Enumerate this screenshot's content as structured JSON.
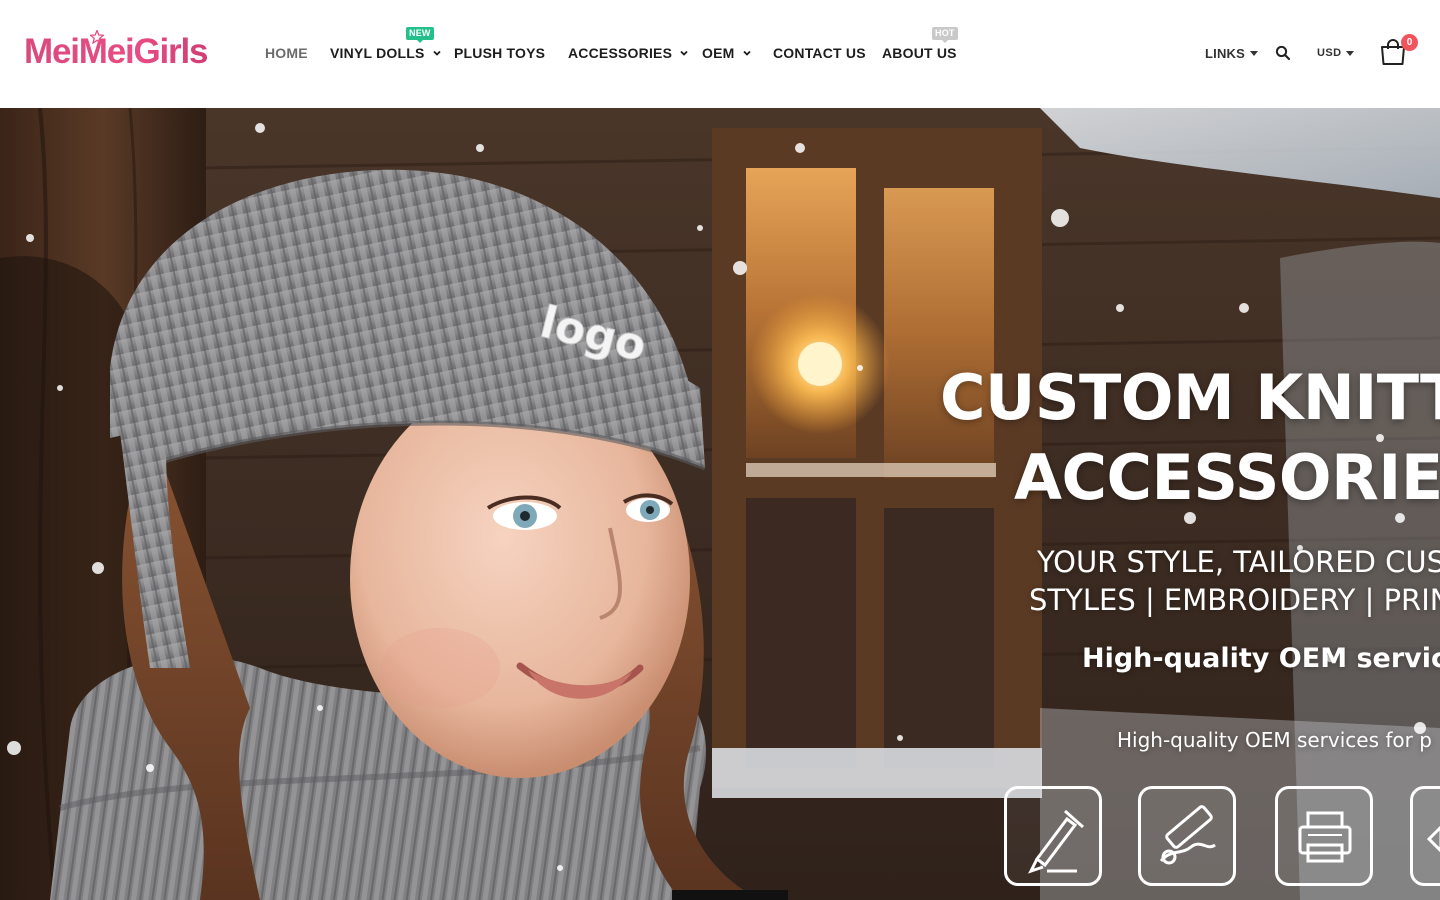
{
  "header": {
    "logo_text": "MeiMeiGirls",
    "nav": [
      {
        "label": "HOME",
        "active": true,
        "dropdown": false,
        "badge": null
      },
      {
        "label": "VINYL DOLLS",
        "active": false,
        "dropdown": true,
        "badge": "NEW"
      },
      {
        "label": "PLUSH TOYS",
        "active": false,
        "dropdown": false,
        "badge": null
      },
      {
        "label": "ACCESSORIES",
        "active": false,
        "dropdown": true,
        "badge": null
      },
      {
        "label": "OEM",
        "active": false,
        "dropdown": true,
        "badge": null
      },
      {
        "label": "CONTACT US",
        "active": false,
        "dropdown": false,
        "badge": null
      },
      {
        "label": "ABOUT US",
        "active": false,
        "dropdown": false,
        "badge": "HOT"
      }
    ],
    "links_label": "LINKS",
    "currency": "USD",
    "cart_count": "0",
    "icons": {
      "search": "search-icon",
      "cart": "cart-icon",
      "chevron": "chevron-down-icon"
    }
  },
  "hero": {
    "beanie_logo": "logo",
    "title_line1": "CUSTOM KNITTE",
    "title_line2": "ACCESSORIE",
    "subtitle_line1": "YOUR STYLE, TAILORED CUS",
    "subtitle_line2": "STYLES | EMBROIDERY | PRIN",
    "oem_line": "High-quality OEM servic",
    "oem_line_small": "High-quality OEM services for p",
    "feature_icons": [
      "pen-nib-icon",
      "measuring-tape-icon",
      "printer-icon",
      "partial-icon"
    ]
  },
  "colors": {
    "brand_pink": "#e84d83",
    "badge_new": "#24c08b",
    "badge_hot": "#c9c9c9",
    "cart_badge": "#f0545c"
  }
}
